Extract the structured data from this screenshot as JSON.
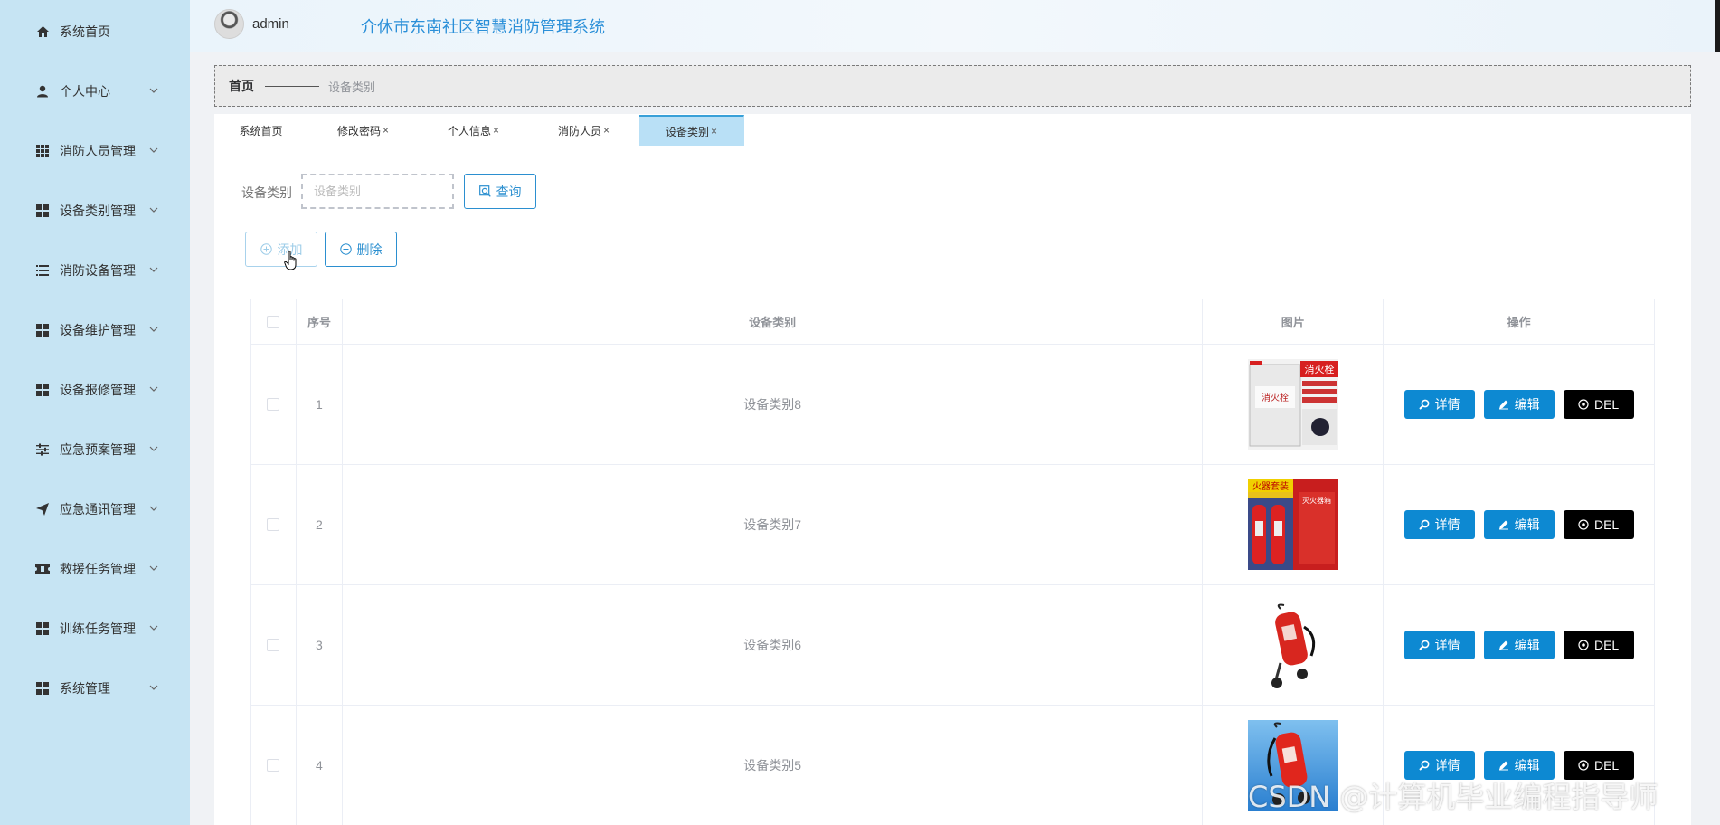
{
  "header": {
    "username": "admin",
    "title": "介休市东南社区智慧消防管理系统"
  },
  "sidebar": {
    "items": [
      {
        "label": "系统首页",
        "icon": "home-icon",
        "arrow": false
      },
      {
        "label": "个人中心",
        "icon": "user-icon",
        "arrow": true
      },
      {
        "label": "消防人员管理",
        "icon": "grid-icon",
        "arrow": true
      },
      {
        "label": "设备类别管理",
        "icon": "apps-icon",
        "arrow": true
      },
      {
        "label": "消防设备管理",
        "icon": "list-icon",
        "arrow": true
      },
      {
        "label": "设备维护管理",
        "icon": "apps-icon",
        "arrow": true
      },
      {
        "label": "设备报修管理",
        "icon": "apps-icon",
        "arrow": true
      },
      {
        "label": "应急预案管理",
        "icon": "sliders-icon",
        "arrow": true
      },
      {
        "label": "应急通讯管理",
        "icon": "send-icon",
        "arrow": true
      },
      {
        "label": "救援任务管理",
        "icon": "ticket-icon",
        "arrow": true
      },
      {
        "label": "训练任务管理",
        "icon": "apps-icon",
        "arrow": true
      },
      {
        "label": "系统管理",
        "icon": "apps-icon",
        "arrow": true
      }
    ]
  },
  "breadcrumb": {
    "home": "首页",
    "current": "设备类别"
  },
  "tabs": [
    {
      "label": "系统首页",
      "closable": false
    },
    {
      "label": "修改密码",
      "closable": true
    },
    {
      "label": "个人信息",
      "closable": true
    },
    {
      "label": "消防人员",
      "closable": true
    },
    {
      "label": "设备类别",
      "closable": true,
      "active": true
    }
  ],
  "search": {
    "label": "设备类别",
    "placeholder": "设备类别",
    "value": "",
    "query_label": "查询"
  },
  "actions": {
    "add_label": "添加",
    "delete_label": "删除"
  },
  "table": {
    "headers": {
      "index": "序号",
      "category": "设备类别",
      "image": "图片",
      "ops": "操作"
    },
    "rows": [
      {
        "index": "1",
        "category": "设备类别8",
        "image": "hydrant-box-image"
      },
      {
        "index": "2",
        "category": "设备类别7",
        "image": "extinguisher-set-image"
      },
      {
        "index": "3",
        "category": "设备类别6",
        "image": "cart-extinguisher-image"
      },
      {
        "index": "4",
        "category": "设备类别5",
        "image": "cart-extinguisher-blue-image"
      }
    ],
    "op_labels": {
      "detail": "详情",
      "edit": "编辑",
      "delete": "DEL"
    }
  },
  "watermark": "CSDN @计算机毕业编程指导师",
  "colors": {
    "sidebar": "#c6e4f3",
    "accent": "#0d89d2",
    "delete_btn": "#000000",
    "active_tab": "#b9e0f6"
  }
}
